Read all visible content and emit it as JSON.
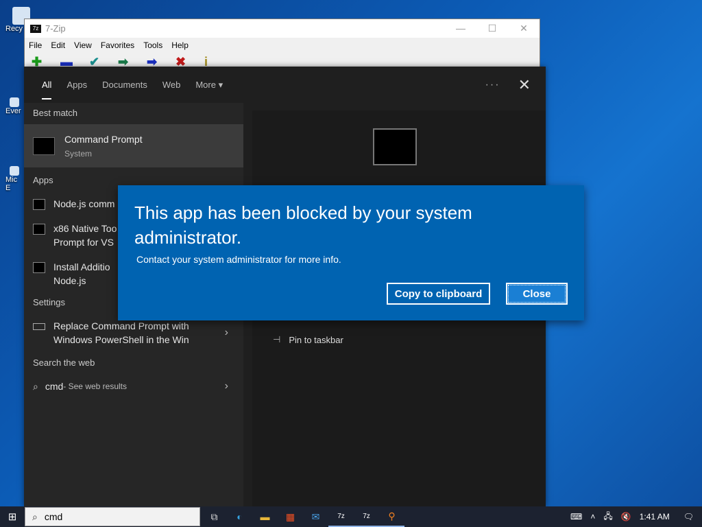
{
  "desktop": {
    "icons": [
      {
        "label": "Recy"
      },
      {
        "label": "Ever"
      },
      {
        "label": "Mic\nE"
      }
    ]
  },
  "zip_window": {
    "title": "7-Zip",
    "logo": "7z",
    "menu": [
      "File",
      "Edit",
      "View",
      "Favorites",
      "Tools",
      "Help"
    ],
    "toolbar_icons": [
      "add-icon",
      "extract-icon",
      "test-icon",
      "copy-icon",
      "move-icon",
      "delete-icon",
      "info-icon"
    ]
  },
  "search_panel": {
    "tabs": [
      "All",
      "Apps",
      "Documents",
      "Web",
      "More"
    ],
    "more_caret": "▾",
    "options_glyph": "···",
    "close_glyph": "✕",
    "best_match_header": "Best match",
    "best_match": {
      "title": "Command Prompt",
      "subtitle": "System"
    },
    "apps_header": "Apps",
    "apps": [
      {
        "line1": "Node.js comm",
        "line2": ""
      },
      {
        "line1": "x86 Native Too",
        "line2": "Prompt for VS"
      },
      {
        "line1": "Install Additio",
        "line2": "Node.js"
      }
    ],
    "settings_header": "Settings",
    "settings_item": {
      "line1": "Replace Command Prompt with",
      "line2": "Windows PowerShell in the Win"
    },
    "web_header": "Search the web",
    "web_item": {
      "query": "cmd",
      "suffix": " - See web results"
    },
    "preview_action": "Pin to taskbar"
  },
  "dialog": {
    "heading": "This app has been blocked by your system administrator.",
    "message": "Contact your system administrator for more info.",
    "copy_label": "Copy to clipboard",
    "close_label": "Close"
  },
  "taskbar": {
    "search_value": "cmd",
    "clock": "1:41 AM",
    "apps": [
      "task-view-icon",
      "edge-icon",
      "file-explorer-icon",
      "store-icon",
      "mail-icon",
      "7zip-icon",
      "7zip-icon",
      "search-app-icon"
    ]
  }
}
